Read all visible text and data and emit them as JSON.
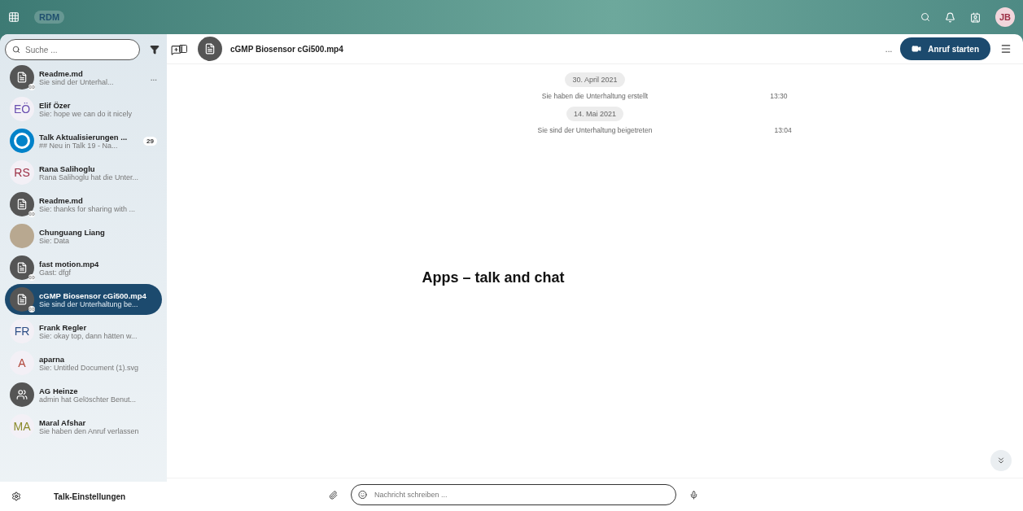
{
  "topbar": {
    "logo": "RDM",
    "avatar_initials": "JB"
  },
  "sidebar": {
    "search": {
      "placeholder": "Suche ..."
    },
    "conversations": [
      {
        "name": "Readme.md",
        "preview": "Sie sind der Unterhal...",
        "kind": "file",
        "menu": "...",
        "selected": false
      },
      {
        "name": "Elif Özer",
        "preview": "Sie: hope we can do it nicely",
        "kind": "initials",
        "initials": "EÖ",
        "color": "#6a4fb0",
        "selected": false
      },
      {
        "name": "Talk Aktualisierungen ...",
        "preview": "## Neu in Talk 19 - Na...",
        "kind": "logo",
        "badge": "29",
        "selected": false
      },
      {
        "name": "Rana Salihoglu",
        "preview": "Rana Salihoglu hat die Unter...",
        "kind": "initials",
        "initials": "RS",
        "color": "#9c2f45",
        "selected": false
      },
      {
        "name": "Readme.md",
        "preview": "Sie: thanks for sharing with ...",
        "kind": "file",
        "selected": false
      },
      {
        "name": "Chunguang Liang",
        "preview": "Sie: Data",
        "kind": "photo",
        "selected": false
      },
      {
        "name": "fast motion.mp4",
        "preview": "Gast: dfgf",
        "kind": "file",
        "selected": false
      },
      {
        "name": "cGMP Biosensor cGi500.mp4",
        "preview": "Sie sind der Unterhaltung be...",
        "kind": "file",
        "selected": true
      },
      {
        "name": "Frank Regler",
        "preview": "Sie: okay top, dann hätten w...",
        "kind": "initials",
        "initials": "FR",
        "color": "#2f4f86",
        "selected": false
      },
      {
        "name": "aparna",
        "preview": "Sie: Untitled Document (1).svg",
        "kind": "initials",
        "initials": "A",
        "color": "#b0463a",
        "selected": false
      },
      {
        "name": "AG Heinze",
        "preview": "admin hat Gelöschter Benut...",
        "kind": "group",
        "selected": false
      },
      {
        "name": "Maral Afshar",
        "preview": "Sie haben den Anruf verlassen",
        "kind": "initials",
        "initials": "MA",
        "color": "#8a8a2a",
        "selected": false
      }
    ],
    "settings": "Talk-Einstellungen"
  },
  "chat": {
    "title": "cGMP Biosensor cGi500.mp4",
    "more": "...",
    "call_button": "Anruf starten",
    "messages": [
      {
        "kind": "date",
        "text": "30. April 2021"
      },
      {
        "kind": "system",
        "text": "Sie haben die Unterhaltung erstellt",
        "time": "13:30"
      },
      {
        "kind": "date",
        "text": "14. Mai 2021"
      },
      {
        "kind": "system",
        "text": "Sie sind der Unterhaltung beigetreten",
        "time": "13:04"
      }
    ],
    "composer": {
      "placeholder": "Nachricht schreiben ..."
    }
  },
  "caption": "Apps – talk and chat"
}
